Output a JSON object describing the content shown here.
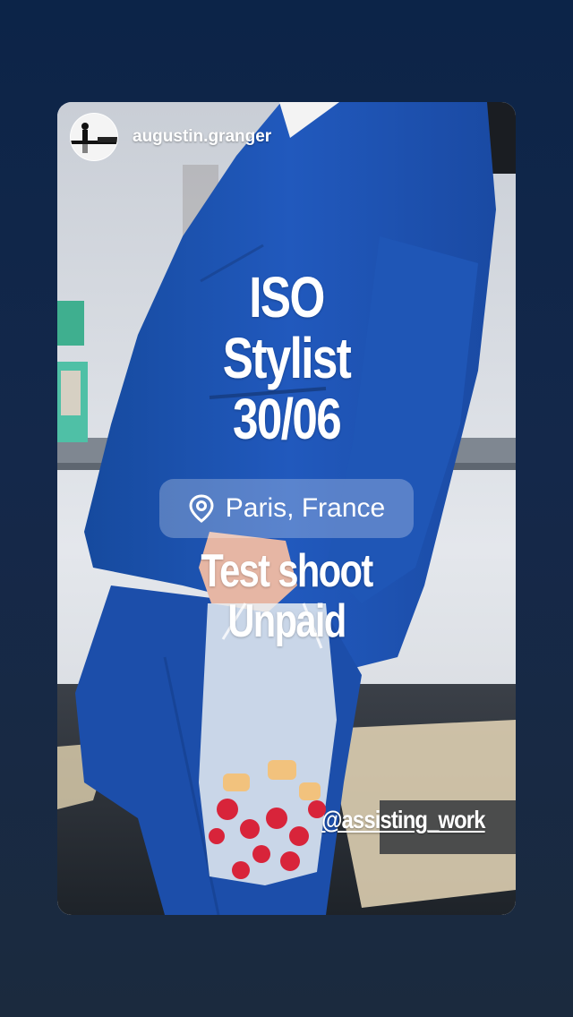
{
  "story": {
    "username": "augustin.granger",
    "headline_lines": [
      "ISO",
      "Stylist",
      "30/06"
    ],
    "location_label": "Paris, France",
    "subline_lines": [
      "Test shoot",
      "Unpaid"
    ],
    "mention": "@assisting_work"
  },
  "icons": {
    "avatar": "profile-photo",
    "location": "location-pin-icon"
  },
  "colors": {
    "background_top": "#0c2448",
    "background_bottom": "#1b2a3e",
    "suit_blue": "#1f55b8",
    "text": "#ffffff"
  }
}
